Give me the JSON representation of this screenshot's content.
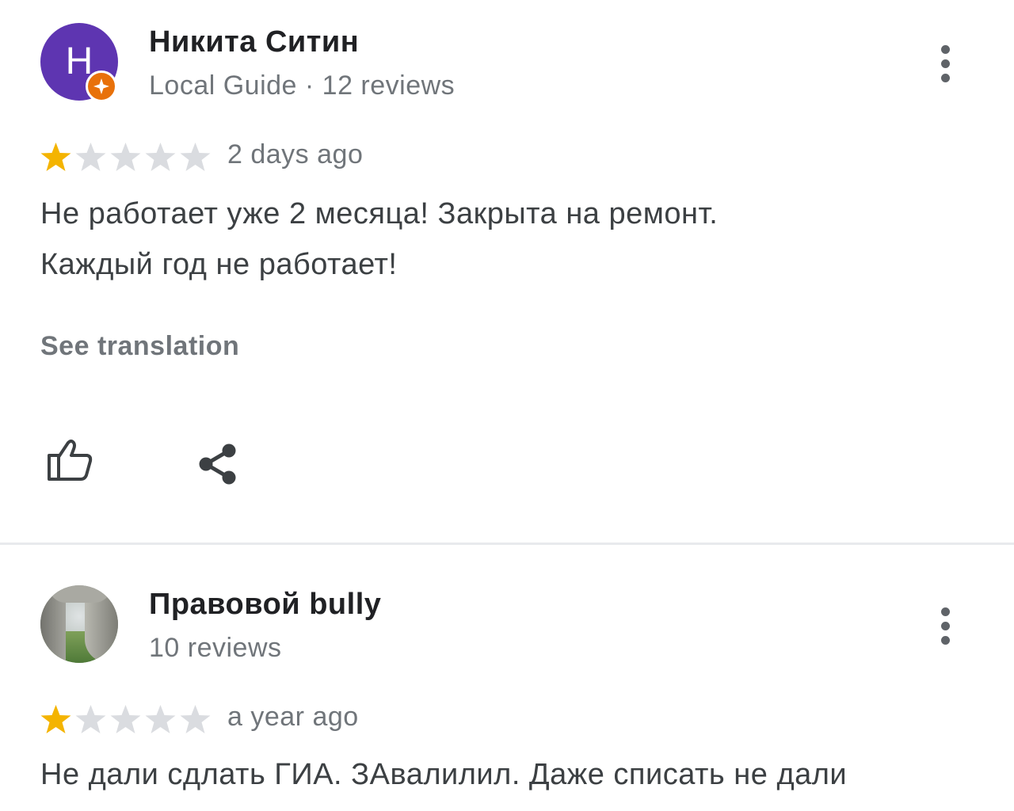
{
  "reviews": [
    {
      "avatar_letter": "H",
      "avatar_color": "#5e35b1",
      "badge_color": "#e8710a",
      "author": "Никита Ситин",
      "meta": "Local Guide · 12 reviews",
      "rating": 1,
      "max_rating": 5,
      "time": "2 days ago",
      "text_lines": [
        "Не работает уже 2 месяца! Закрыта на ремонт.",
        "Каждый год не работает!"
      ],
      "see_translation": "See translation",
      "icons": [
        "thumbs-up-icon",
        "share-icon",
        "more-vert-icon",
        "local-guide-badge-icon"
      ]
    },
    {
      "avatar_type": "landscape-photo",
      "author": "Правовой bully",
      "meta": "10 reviews",
      "rating": 1,
      "max_rating": 5,
      "time": "a year ago",
      "text_lines": [
        "Не дали сдлать ГИА. ЗАвалилил. Даже списать не дали"
      ],
      "icons": [
        "more-vert-icon"
      ]
    }
  ],
  "colors": {
    "star_filled": "#f4b400",
    "star_empty": "#dadce0",
    "secondary_text": "#70757a",
    "divider": "#e8eaed"
  }
}
